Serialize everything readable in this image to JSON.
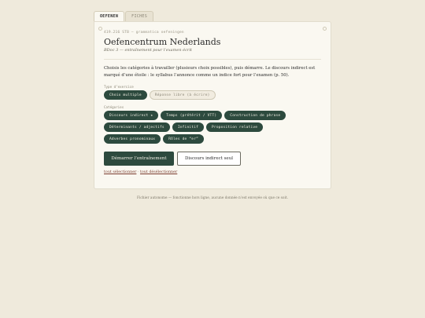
{
  "tabs": [
    {
      "label": "OEFENEN",
      "active": true
    },
    {
      "label": "FICHES",
      "active": false
    }
  ],
  "meta": "419.216 STB — grammatica oefeningen",
  "title": "Oefencentrum Nederlands",
  "subtitle": "BDoc 3 — entraînement pour l’examen écrit",
  "instructions": "Choisis les catégories à travailler (plusieurs choix possibles), puis démarre. Le discours indirect est marqué d’une étoile : le syllabus l’annonce comme un indice fort pour l’examen (p. 50).",
  "exercise_type": {
    "label": "Type d’exercice",
    "options": [
      {
        "label": "Choix multiple",
        "selected": true
      },
      {
        "label": "Réponse libre (à écrire)",
        "selected": false
      }
    ]
  },
  "categories": {
    "label": "Catégories",
    "items": [
      {
        "label": "Discours indirect ★",
        "selected": true
      },
      {
        "label": "Temps (prétérit / VTT)",
        "selected": true
      },
      {
        "label": "Construction de phrase",
        "selected": true
      },
      {
        "label": "Déterminants / adjectifs",
        "selected": true
      },
      {
        "label": "Infinitif",
        "selected": true
      },
      {
        "label": "Proposition relative",
        "selected": true
      },
      {
        "label": "Adverbes pronominaux",
        "selected": true
      },
      {
        "label": "Rôles de “er”",
        "selected": true
      }
    ]
  },
  "actions": {
    "start": "Démarrer l’entraînement",
    "indirect_only": "Discours indirect seul"
  },
  "links": {
    "select_all": "tout sélectionner",
    "separator": "·",
    "deselect_all": "tout désélectionner"
  },
  "footer": "Fichier autonome — fonctionne hors ligne, aucune donnée n’est envoyée où que ce soit.",
  "colors": {
    "background": "#efeadc",
    "card": "#faf8f1",
    "accent": "#2d4a3e",
    "link": "#7a3b2e"
  }
}
